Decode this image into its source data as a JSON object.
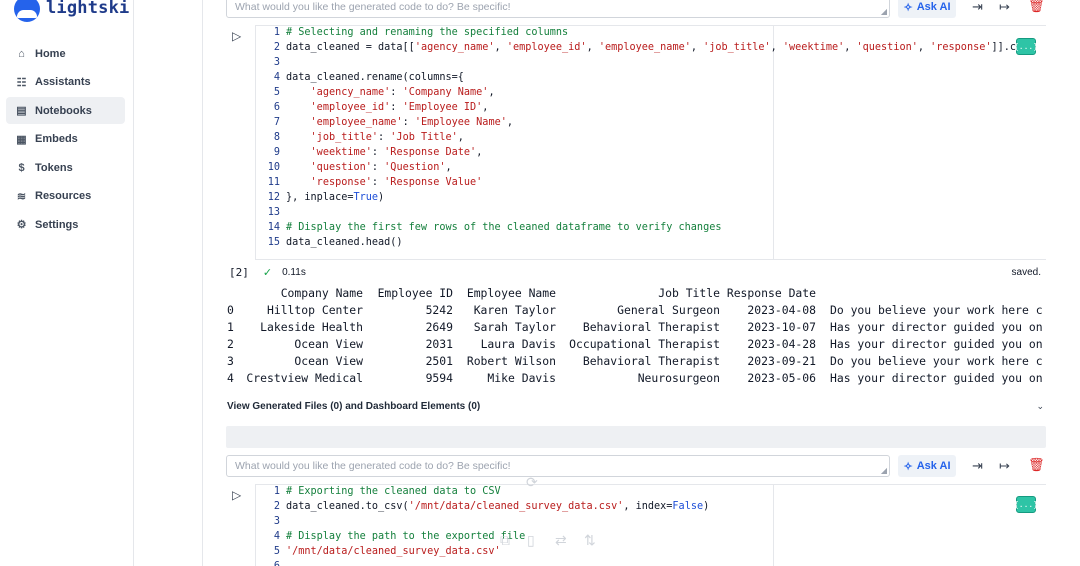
{
  "app": {
    "brand": "lightski",
    "accent": "#2563eb"
  },
  "sidebar": {
    "items": [
      {
        "label": "Home",
        "icon": "home-icon",
        "glyph": "⌂"
      },
      {
        "label": "Assistants",
        "icon": "assistants-icon",
        "glyph": "☷"
      },
      {
        "label": "Notebooks",
        "icon": "notebook-icon",
        "glyph": "▤",
        "active": true
      },
      {
        "label": "Embeds",
        "icon": "embed-icon",
        "glyph": "▦"
      },
      {
        "label": "Tokens",
        "icon": "token-icon",
        "glyph": "$"
      },
      {
        "label": "Resources",
        "icon": "database-icon",
        "glyph": "≋"
      },
      {
        "label": "Settings",
        "icon": "gear-icon",
        "glyph": "⚙"
      }
    ]
  },
  "cell1": {
    "prompt_placeholder": "What would you like the generated code to do? Be specific!",
    "ask_ai": "Ask AI",
    "lines": [
      {
        "n": "1",
        "parts": [
          {
            "t": "# Selecting and renaming the specified columns",
            "c": "comment"
          }
        ]
      },
      {
        "n": "2",
        "parts": [
          {
            "t": "data_cleaned = data[[",
            "c": "plain"
          },
          {
            "t": "'agency_name'",
            "c": "str"
          },
          {
            "t": ", ",
            "c": "plain"
          },
          {
            "t": "'employee_id'",
            "c": "str"
          },
          {
            "t": ", ",
            "c": "plain"
          },
          {
            "t": "'employee_name'",
            "c": "str"
          },
          {
            "t": ", ",
            "c": "plain"
          },
          {
            "t": "'job_title'",
            "c": "str"
          },
          {
            "t": ", ",
            "c": "plain"
          },
          {
            "t": "'weektime'",
            "c": "str"
          },
          {
            "t": ", ",
            "c": "plain"
          },
          {
            "t": "'question'",
            "c": "str"
          },
          {
            "t": ", ",
            "c": "plain"
          },
          {
            "t": "'response'",
            "c": "str"
          },
          {
            "t": "]].co",
            "c": "plain"
          }
        ]
      },
      {
        "n": "3",
        "parts": []
      },
      {
        "n": "4",
        "parts": [
          {
            "t": "data_cleaned.rename(columns={",
            "c": "plain"
          }
        ]
      },
      {
        "n": "5",
        "parts": [
          {
            "t": "    ",
            "c": "plain"
          },
          {
            "t": "'agency_name'",
            "c": "str"
          },
          {
            "t": ": ",
            "c": "plain"
          },
          {
            "t": "'Company Name'",
            "c": "str"
          },
          {
            "t": ",",
            "c": "plain"
          }
        ]
      },
      {
        "n": "6",
        "parts": [
          {
            "t": "    ",
            "c": "plain"
          },
          {
            "t": "'employee_id'",
            "c": "str"
          },
          {
            "t": ": ",
            "c": "plain"
          },
          {
            "t": "'Employee ID'",
            "c": "str"
          },
          {
            "t": ",",
            "c": "plain"
          }
        ]
      },
      {
        "n": "7",
        "parts": [
          {
            "t": "    ",
            "c": "plain"
          },
          {
            "t": "'employee_name'",
            "c": "str"
          },
          {
            "t": ": ",
            "c": "plain"
          },
          {
            "t": "'Employee Name'",
            "c": "str"
          },
          {
            "t": ",",
            "c": "plain"
          }
        ]
      },
      {
        "n": "8",
        "parts": [
          {
            "t": "    ",
            "c": "plain"
          },
          {
            "t": "'job_title'",
            "c": "str"
          },
          {
            "t": ": ",
            "c": "plain"
          },
          {
            "t": "'Job Title'",
            "c": "str"
          },
          {
            "t": ",",
            "c": "plain"
          }
        ]
      },
      {
        "n": "9",
        "parts": [
          {
            "t": "    ",
            "c": "plain"
          },
          {
            "t": "'weektime'",
            "c": "str"
          },
          {
            "t": ": ",
            "c": "plain"
          },
          {
            "t": "'Response Date'",
            "c": "str"
          },
          {
            "t": ",",
            "c": "plain"
          }
        ]
      },
      {
        "n": "10",
        "parts": [
          {
            "t": "    ",
            "c": "plain"
          },
          {
            "t": "'question'",
            "c": "str"
          },
          {
            "t": ": ",
            "c": "plain"
          },
          {
            "t": "'Question'",
            "c": "str"
          },
          {
            "t": ",",
            "c": "plain"
          }
        ]
      },
      {
        "n": "11",
        "parts": [
          {
            "t": "    ",
            "c": "plain"
          },
          {
            "t": "'response'",
            "c": "str"
          },
          {
            "t": ": ",
            "c": "plain"
          },
          {
            "t": "'Response Value'",
            "c": "str"
          }
        ]
      },
      {
        "n": "12",
        "parts": [
          {
            "t": "}, inplace=",
            "c": "plain"
          },
          {
            "t": "True",
            "c": "kw"
          },
          {
            "t": ")",
            "c": "plain"
          }
        ]
      },
      {
        "n": "13",
        "parts": []
      },
      {
        "n": "14",
        "parts": [
          {
            "t": "# Display the first few rows of the cleaned dataframe to verify changes",
            "c": "comment"
          }
        ]
      },
      {
        "n": "15",
        "parts": [
          {
            "t": "data_cleaned.head()",
            "c": "plain"
          }
        ]
      }
    ],
    "exec_count": "[2]",
    "exec_time": "0.11s",
    "saved": "saved."
  },
  "output": {
    "headers": [
      "Company Name",
      "Employee ID",
      "Employee Name",
      "Job Title",
      "Response Date"
    ],
    "rows": [
      [
        "0",
        "Hilltop Center",
        "5242",
        "Karen Taylor",
        "General Surgeon",
        "2023-04-08",
        "Do you believe your work here c"
      ],
      [
        "1",
        "Lakeside Health",
        "2649",
        "Sarah Taylor",
        "Behavioral Therapist",
        "2023-10-07",
        "Has your director guided you on"
      ],
      [
        "2",
        "Ocean View",
        "2031",
        "Laura Davis",
        "Occupational Therapist",
        "2023-04-28",
        "Has your director guided you on"
      ],
      [
        "3",
        "Ocean View",
        "2501",
        "Robert Wilson",
        "Behavioral Therapist",
        "2023-09-21",
        "Do you believe your work here c"
      ],
      [
        "4",
        "Crestview Medical",
        "9594",
        "Mike Davis",
        "Neurosurgeon",
        "2023-05-06",
        "Has your director guided you on"
      ]
    ]
  },
  "generated_files": "View Generated Files (0) and Dashboard Elements (0)",
  "cell2": {
    "prompt_placeholder": "What would you like the generated code to do? Be specific!",
    "ask_ai": "Ask AI",
    "lines": [
      {
        "n": "1",
        "parts": [
          {
            "t": "# Exporting the cleaned data to CSV",
            "c": "comment"
          }
        ]
      },
      {
        "n": "2",
        "parts": [
          {
            "t": "data_cleaned.to_csv(",
            "c": "plain"
          },
          {
            "t": "'/mnt/data/cleaned_survey_data.csv'",
            "c": "str"
          },
          {
            "t": ", index=",
            "c": "plain"
          },
          {
            "t": "False",
            "c": "kw"
          },
          {
            "t": ")",
            "c": "plain"
          }
        ]
      },
      {
        "n": "3",
        "parts": []
      },
      {
        "n": "4",
        "parts": [
          {
            "t": "# Display the path to the exported file",
            "c": "comment"
          }
        ]
      },
      {
        "n": "5",
        "parts": [
          {
            "t": "'/mnt/data/cleaned_survey_data.csv'",
            "c": "str"
          }
        ]
      },
      {
        "n": "6",
        "parts": []
      }
    ]
  },
  "expand_badge": "{...}"
}
